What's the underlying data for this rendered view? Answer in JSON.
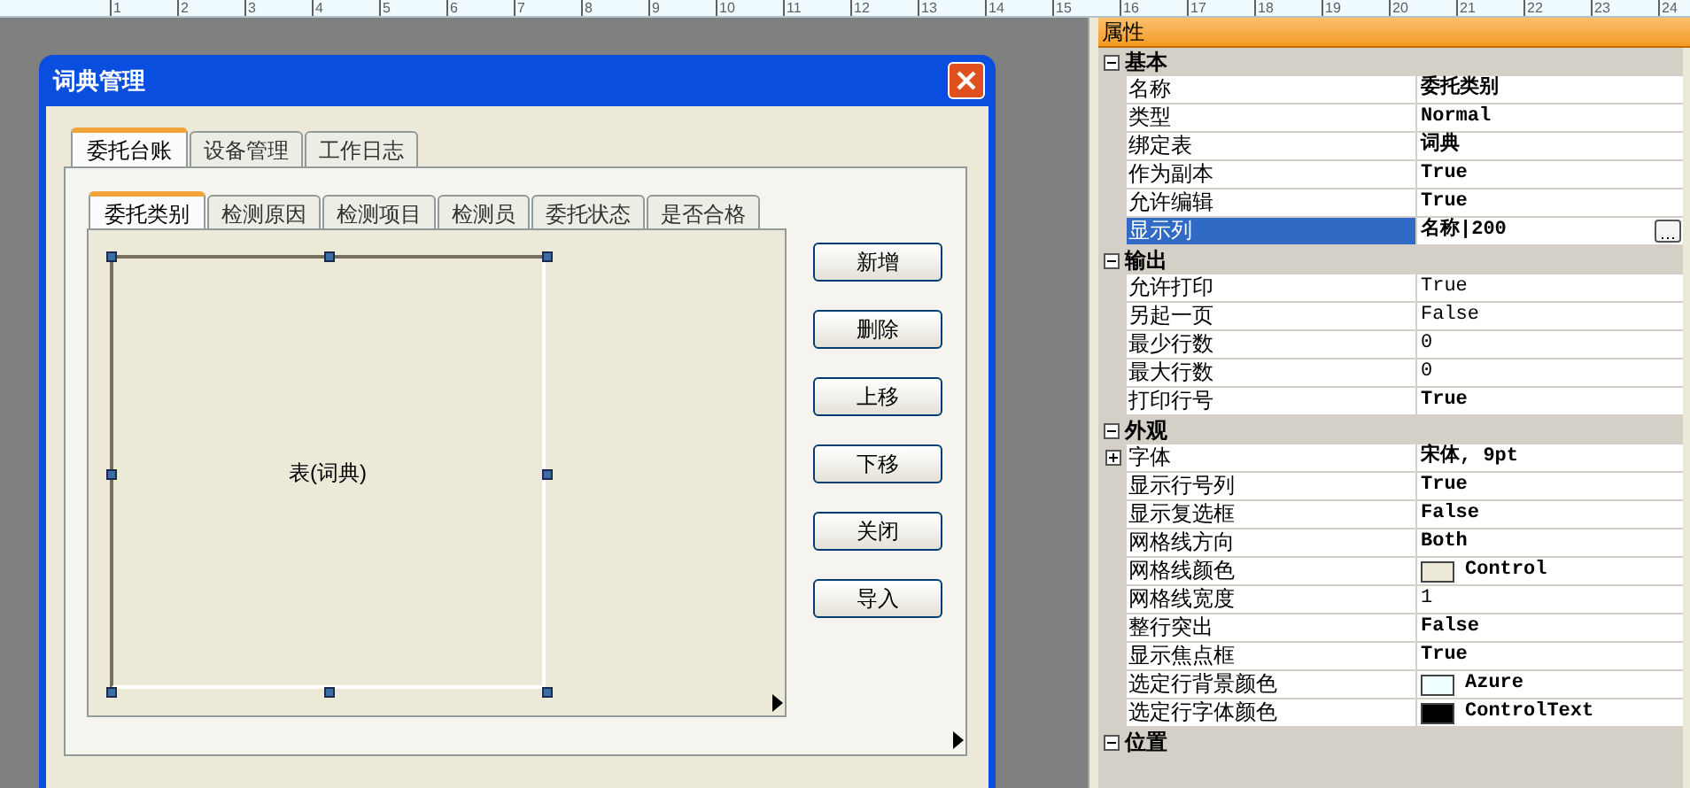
{
  "ruler": {
    "ticks": [
      "1",
      "2",
      "3",
      "4",
      "5",
      "6",
      "7",
      "8",
      "9",
      "10",
      "11",
      "12",
      "13",
      "14",
      "15",
      "16",
      "17",
      "18",
      "19",
      "20",
      "21",
      "22",
      "23",
      "24"
    ]
  },
  "dialog": {
    "title": "词典管理",
    "tabs": [
      {
        "label": "委托台账",
        "selected": true
      },
      {
        "label": "设备管理",
        "selected": false
      },
      {
        "label": "工作日志",
        "selected": false
      }
    ],
    "inner_tabs": [
      {
        "label": "委托类别",
        "selected": true
      },
      {
        "label": "检测原因",
        "selected": false
      },
      {
        "label": "检测项目",
        "selected": false
      },
      {
        "label": "检测员",
        "selected": false
      },
      {
        "label": "委托状态",
        "selected": false
      },
      {
        "label": "是否合格",
        "selected": false
      }
    ],
    "table_label": "表(词典)",
    "buttons": [
      "新增",
      "删除",
      "上移",
      "下移",
      "关闭",
      "导入"
    ]
  },
  "properties": {
    "title": "属性",
    "groups": [
      {
        "name": "基本",
        "expanded": true,
        "rows": [
          {
            "name": "名称",
            "value": "委托类别",
            "kind": "text",
            "modified": true,
            "selected": false
          },
          {
            "name": "类型",
            "value": "Normal",
            "kind": "text",
            "modified": true,
            "selected": false
          },
          {
            "name": "绑定表",
            "value": "词典",
            "kind": "text",
            "modified": true,
            "selected": false
          },
          {
            "name": "作为副本",
            "value": "True",
            "kind": "text",
            "modified": true,
            "selected": false
          },
          {
            "name": "允许编辑",
            "value": "True",
            "kind": "text",
            "modified": true,
            "selected": false
          },
          {
            "name": "显示列",
            "value": "名称|200",
            "kind": "text",
            "modified": true,
            "selected": true
          }
        ]
      },
      {
        "name": "输出",
        "expanded": true,
        "rows": [
          {
            "name": "允许打印",
            "value": "True",
            "kind": "text",
            "modified": false,
            "selected": false
          },
          {
            "name": "另起一页",
            "value": "False",
            "kind": "text",
            "modified": false,
            "selected": false
          },
          {
            "name": "最少行数",
            "value": "0",
            "kind": "text",
            "modified": false,
            "selected": false
          },
          {
            "name": "最大行数",
            "value": "0",
            "kind": "text",
            "modified": false,
            "selected": false
          },
          {
            "name": "打印行号",
            "value": "True",
            "kind": "text",
            "modified": true,
            "selected": false
          }
        ]
      },
      {
        "name": "外观",
        "expanded": true,
        "rows": [
          {
            "name": "字体",
            "value": "宋体, 9pt",
            "kind": "font",
            "modified": true,
            "selected": false
          },
          {
            "name": "显示行号列",
            "value": "True",
            "kind": "text",
            "modified": true,
            "selected": false
          },
          {
            "name": "显示复选框",
            "value": "False",
            "kind": "text",
            "modified": true,
            "selected": false
          },
          {
            "name": "网格线方向",
            "value": "Both",
            "kind": "text",
            "modified": true,
            "selected": false
          },
          {
            "name": "网格线颜色",
            "value": "Control",
            "kind": "color",
            "color": "#ece9d8",
            "modified": true,
            "selected": false
          },
          {
            "name": "网格线宽度",
            "value": "1",
            "kind": "text",
            "modified": false,
            "selected": false
          },
          {
            "name": "整行突出",
            "value": "False",
            "kind": "text",
            "modified": true,
            "selected": false
          },
          {
            "name": "显示焦点框",
            "value": "True",
            "kind": "text",
            "modified": true,
            "selected": false
          },
          {
            "name": "选定行背景颜色",
            "value": "Azure",
            "kind": "color",
            "color": "#f0ffff",
            "modified": true,
            "selected": false
          },
          {
            "name": "选定行字体颜色",
            "value": "ControlText",
            "kind": "color",
            "color": "#000000",
            "modified": true,
            "selected": false
          }
        ]
      },
      {
        "name": "位置",
        "expanded": true
      }
    ]
  }
}
